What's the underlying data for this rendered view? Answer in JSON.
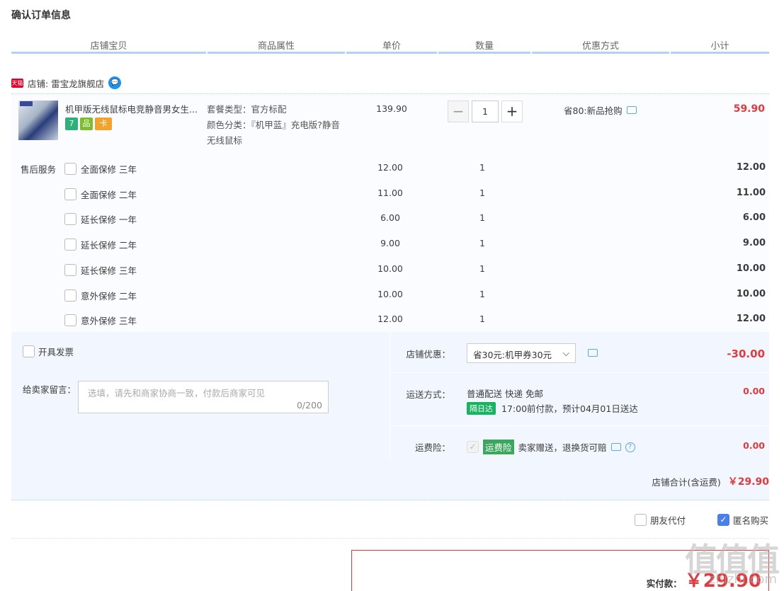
{
  "title": "确认订单信息",
  "columns": [
    "店铺宝贝",
    "商品属性",
    "单价",
    "数量",
    "优惠方式",
    "小计"
  ],
  "shop": {
    "badge": "天猫",
    "label": "店铺: 雷宝龙旗舰店"
  },
  "product": {
    "title": "机甲版无线鼠标电竞静音男女生...",
    "attr_line1": "套餐类型：官方标配",
    "attr_line2": "颜色分类：『机甲蓝』充电版?静音无线鼠标",
    "price": "139.90",
    "qty": "1",
    "qty_minus": "−",
    "qty_plus": "+",
    "promo": "省80:新品抢购",
    "subtotal": "59.90",
    "tags": [
      "7",
      "品",
      "卡"
    ]
  },
  "services": {
    "label": "售后服务",
    "items": [
      {
        "name": "全面保修 三年",
        "price": "12.00",
        "qty": "1",
        "subtotal": "12.00"
      },
      {
        "name": "全面保修 二年",
        "price": "11.00",
        "qty": "1",
        "subtotal": "11.00"
      },
      {
        "name": "延长保修 一年",
        "price": "6.00",
        "qty": "1",
        "subtotal": "6.00"
      },
      {
        "name": "延长保修 二年",
        "price": "9.00",
        "qty": "1",
        "subtotal": "9.00"
      },
      {
        "name": "延长保修 三年",
        "price": "10.00",
        "qty": "1",
        "subtotal": "10.00"
      },
      {
        "name": "意外保修 二年",
        "price": "10.00",
        "qty": "1",
        "subtotal": "10.00"
      },
      {
        "name": "意外保修 三年",
        "price": "12.00",
        "qty": "1",
        "subtotal": "12.00"
      }
    ]
  },
  "invoice_label": "开具发票",
  "message": {
    "label": "给卖家留言：",
    "placeholder": "选填，请先和商家协商一致，付款后商家可见",
    "counter": "0/200"
  },
  "shop_discount": {
    "label": "店铺优惠：",
    "value": "省30元:机甲券30元",
    "amount": "-30.00"
  },
  "shipping": {
    "label": "运送方式：",
    "method": "普通配送 快递 免邮",
    "badge": "隔日达",
    "eta": "17:00前付款，预计04月01日送达",
    "amount": "0.00"
  },
  "insurance": {
    "label": "运费险：",
    "badge": "运费险",
    "text": "卖家赠送，退换货可赔",
    "help": "?",
    "amount": "0.00"
  },
  "shop_total": {
    "label": "店铺合计(含运费)",
    "amount": "￥29.90"
  },
  "friend_pay": "朋友代付",
  "anonymous": "匿名购买",
  "pay": {
    "label": "实付款：",
    "amount": "￥29.90"
  },
  "watermark": {
    "text": "值值值",
    "url": "zhizhi.com"
  }
}
